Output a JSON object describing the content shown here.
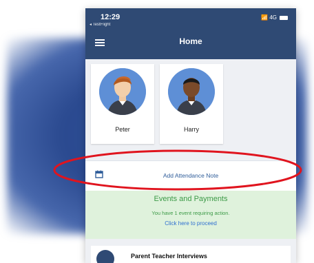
{
  "status": {
    "time": "12:29",
    "back_app": "◂ TestFlight",
    "signal": "📶 4G"
  },
  "header": {
    "title": "Home",
    "menu_icon": "hamburger-menu-icon"
  },
  "children": [
    {
      "name": "Peter",
      "avatar_icon": "male-avatar-icon"
    },
    {
      "name": "Harry",
      "avatar_icon": "male-avatar-icon"
    }
  ],
  "attendance": {
    "label": "Add Attendance Note",
    "icon": "calendar-icon"
  },
  "events": {
    "title": "Events and Payments",
    "subtitle": "You have 1 event requiring action.",
    "link": "Click here to proceed"
  },
  "interviews": {
    "label": "Parent Teacher Interviews"
  },
  "colors": {
    "header_bg": "#2f4a74",
    "link_blue": "#2f6fd0",
    "events_green": "#3c9a47",
    "events_bg": "#dff2dc",
    "highlight_red": "#e0141e"
  }
}
